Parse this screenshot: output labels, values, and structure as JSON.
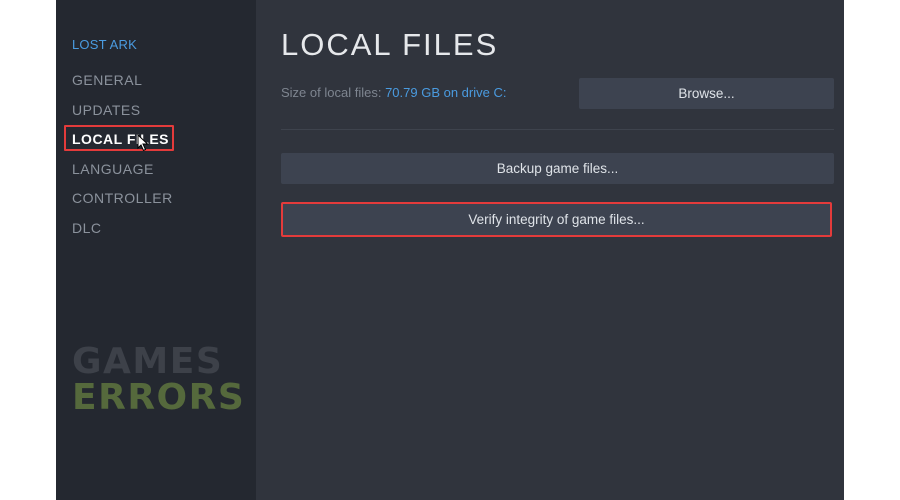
{
  "sidebar": {
    "game_title": "LOST ARK",
    "items": [
      {
        "label": "GENERAL",
        "active": false
      },
      {
        "label": "UPDATES",
        "active": false
      },
      {
        "label": "LOCAL FILES",
        "active": true
      },
      {
        "label": "LANGUAGE",
        "active": false
      },
      {
        "label": "CONTROLLER",
        "active": false
      },
      {
        "label": "DLC",
        "active": false
      }
    ]
  },
  "main": {
    "title": "LOCAL FILES",
    "size_label": "Size of local files:",
    "size_value": "70.79 GB on drive C:",
    "browse_label": "Browse...",
    "backup_label": "Backup game files...",
    "verify_label": "Verify integrity of game files..."
  },
  "watermark": {
    "line1": "GAMES",
    "line2": "ERRORS"
  },
  "colors": {
    "window_bg": "#30343d",
    "sidebar_bg": "#242830",
    "accent_blue": "#4a9be0",
    "highlight_red": "#e43b3b",
    "button_bg": "#3d4350"
  },
  "icons": {
    "cursor": "mouse-pointer-icon"
  }
}
